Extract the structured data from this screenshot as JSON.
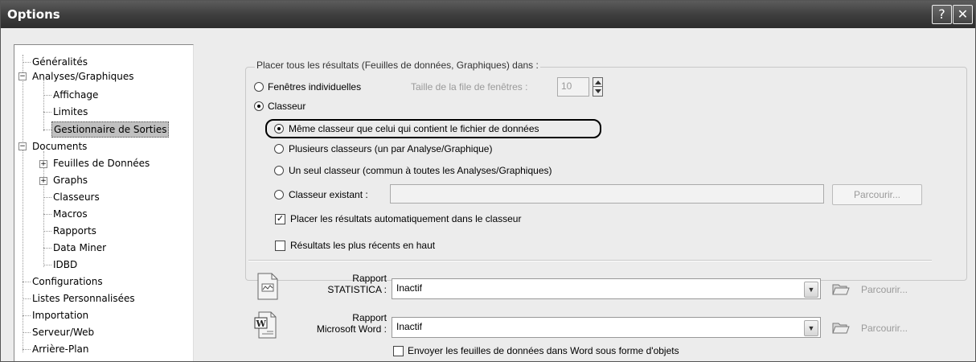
{
  "window": {
    "title": "Options",
    "help_btn": "?",
    "close_btn": "✕"
  },
  "tree": {
    "items": [
      {
        "label": "Généralités"
      },
      {
        "label": "Analyses/Graphiques",
        "expander": "−"
      },
      {
        "label": "Affichage"
      },
      {
        "label": "Limites"
      },
      {
        "label": "Gestionnaire de Sorties",
        "selected": true
      },
      {
        "label": "Documents",
        "expander": "−"
      },
      {
        "label": "Feuilles de Données",
        "expander": "+"
      },
      {
        "label": "Graphs",
        "expander": "+"
      },
      {
        "label": "Classeurs"
      },
      {
        "label": "Macros"
      },
      {
        "label": "Rapports"
      },
      {
        "label": "Data Miner"
      },
      {
        "label": "IDBD"
      },
      {
        "label": "Configurations"
      },
      {
        "label": "Listes Personnalisées"
      },
      {
        "label": "Importation"
      },
      {
        "label": "Serveur/Web"
      },
      {
        "label": "Arrière-Plan"
      }
    ]
  },
  "output": {
    "group_label": "Placer tous les résultats (Feuilles de données, Graphiques) dans :",
    "radio_individual": "Fenêtres individuelles",
    "queue_label": "Taille de la file de fenêtres :",
    "queue_value": "10",
    "radio_workbook": "Classeur",
    "opt_same": "Même classeur que celui qui contient le fichier de données",
    "opt_multiple": "Plusieurs classeurs (un par Analyse/Graphique)",
    "opt_single": "Un seul classeur (commun à toutes les Analyses/Graphiques)",
    "opt_existing": "Classeur existant :",
    "existing_value": "",
    "browse": "Parcourir...",
    "auto_place": "Placer les résultats automatiquement dans le classeur",
    "auto_place_checked": true,
    "recent_top": "Résultats les plus récents en haut",
    "recent_top_checked": false
  },
  "report": {
    "stat_label_1": "Rapport",
    "stat_label_2": "STATISTICA :",
    "stat_value": "Inactif",
    "word_label_1": "Rapport",
    "word_label_2": "Microsoft Word :",
    "word_value": "Inactif",
    "browse": "Parcourir...",
    "send_objects": "Envoyer les feuilles de données dans Word sous forme d'objets",
    "send_objects_checked": false
  },
  "icons": {
    "dropdown": "chevron-down-icon",
    "folder": "folder-open-icon",
    "doc": "document-icon",
    "word": "word-document-icon"
  }
}
